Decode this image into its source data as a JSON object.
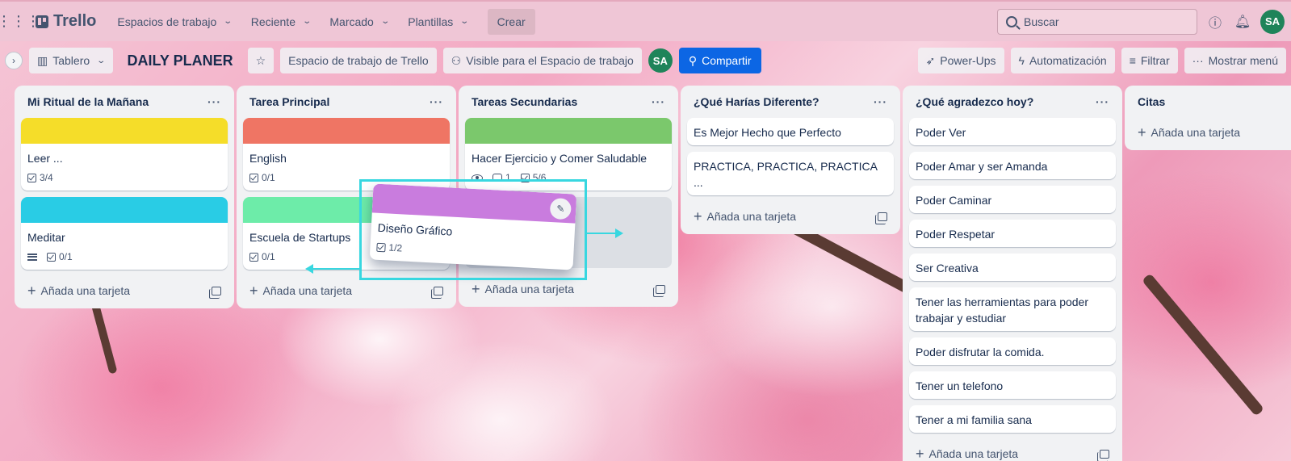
{
  "nav": {
    "logo": "Trello",
    "items": [
      {
        "label": "Espacios de trabajo"
      },
      {
        "label": "Reciente"
      },
      {
        "label": "Marcado"
      },
      {
        "label": "Plantillas"
      }
    ],
    "create": "Crear",
    "search_placeholder": "Buscar",
    "avatar": "SA"
  },
  "board": {
    "view": "Tablero",
    "title": "DAILY PLANER",
    "workspace": "Espacio de trabajo de Trello",
    "visibility": "Visible para el Espacio de trabajo",
    "member_avatar": "SA",
    "share": "Compartir",
    "powerups": "Power-Ups",
    "automation": "Automatización",
    "filter": "Filtrar",
    "menu": "Mostrar menú"
  },
  "add_card_label": "Añada una tarjeta",
  "lists": [
    {
      "title": "Mi Ritual de la Mañana",
      "cards": [
        {
          "title": "Leer ...",
          "cover": "#f5dd29",
          "checklist": "3/4"
        },
        {
          "title": "Meditar",
          "cover": "#29cce5",
          "checklist": "0/1",
          "description": true
        }
      ]
    },
    {
      "title": "Tarea Principal",
      "cards": [
        {
          "title": "English",
          "cover": "#ef7564",
          "checklist": "0/1"
        },
        {
          "title": "Escuela de Startups",
          "cover": "#6deca9",
          "checklist": "0/1"
        }
      ]
    },
    {
      "title": "Tareas Secundarias",
      "cards": [
        {
          "title": "Hacer Ejercicio y Comer Saludable",
          "cover": "#7bc86c",
          "comments": "1",
          "checklist": "5/6"
        }
      ]
    },
    {
      "title": "¿Qué Harías Diferente?",
      "cards": [
        {
          "title": "Es Mejor Hecho que Perfecto"
        },
        {
          "title": "PRACTICA, PRACTICA, PRACTICA ..."
        }
      ]
    },
    {
      "title": "¿Qué agradezco hoy?",
      "cards": [
        {
          "title": "Poder Ver"
        },
        {
          "title": "Poder Amar y ser Amanda"
        },
        {
          "title": "Poder Caminar"
        },
        {
          "title": "Poder Respetar"
        },
        {
          "title": "Ser Creativa"
        },
        {
          "title": "Tener las herramientas para poder trabajar y estudiar"
        },
        {
          "title": "Poder disfrutar la comida."
        },
        {
          "title": "Tener un telefono"
        },
        {
          "title": "Tener a mi familia sana"
        }
      ]
    },
    {
      "title": "Citas",
      "cards": []
    }
  ],
  "drag_card": {
    "title": "Diseño Gráfico",
    "cover": "#c97cde",
    "checklist": "1/2"
  }
}
